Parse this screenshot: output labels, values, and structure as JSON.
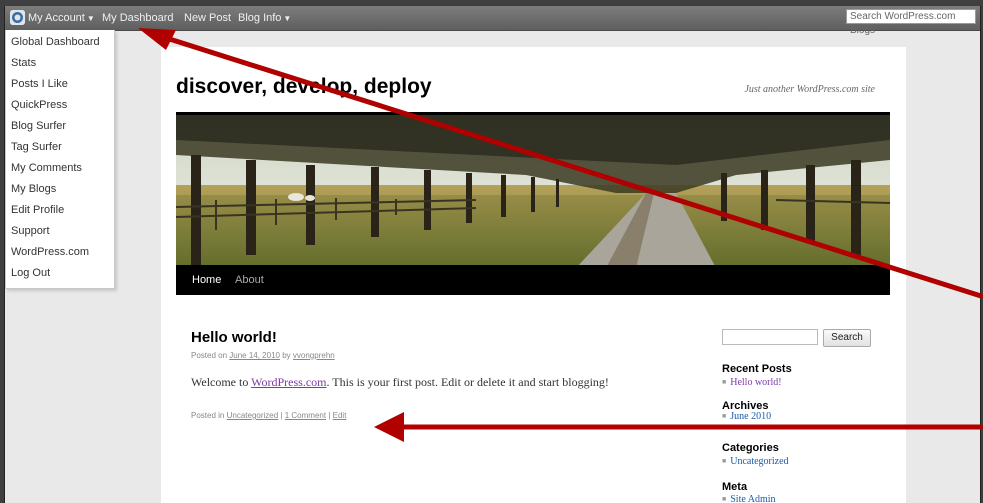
{
  "admin_bar": {
    "my_account": "My Account",
    "my_dashboard": "My Dashboard",
    "new_post": "New Post",
    "blog_info": "Blog Info",
    "search_placeholder": "Search WordPress.com Blogs"
  },
  "account_menu": [
    "Global Dashboard",
    "Stats",
    "Posts I Like",
    "QuickPress",
    "Blog Surfer",
    "Tag Surfer",
    "My Comments",
    "My Blogs",
    "Edit Profile",
    "Support",
    "WordPress.com",
    "Log Out"
  ],
  "site": {
    "title": "discover, develop, deploy",
    "description": "Just another WordPress.com site"
  },
  "nav": {
    "home": "Home",
    "about": "About"
  },
  "post": {
    "title": "Hello world!",
    "posted_on": "Posted on",
    "date": "June 14, 2010",
    "by": "by",
    "author": "vvongprehn",
    "body_pre": "Welcome to ",
    "body_link": "WordPress.com",
    "body_post": ". This is your first post. Edit or delete it and start blogging!",
    "posted_in": "Posted in",
    "category": "Uncategorized",
    "sep": "|",
    "comments": "1 Comment",
    "edit": "Edit"
  },
  "sidebar": {
    "search_button": "Search",
    "recent_posts_title": "Recent Posts",
    "recent_posts": [
      "Hello world!"
    ],
    "archives_title": "Archives",
    "archives": [
      "June 2010"
    ],
    "categories_title": "Categories",
    "categories": [
      "Uncategorized"
    ],
    "meta_title": "Meta",
    "meta": [
      "Site Admin"
    ]
  },
  "colors": {
    "annotation_arrow": "#b00000",
    "link_purple": "#7c3aa6",
    "link_blue": "#1a5aa8"
  }
}
